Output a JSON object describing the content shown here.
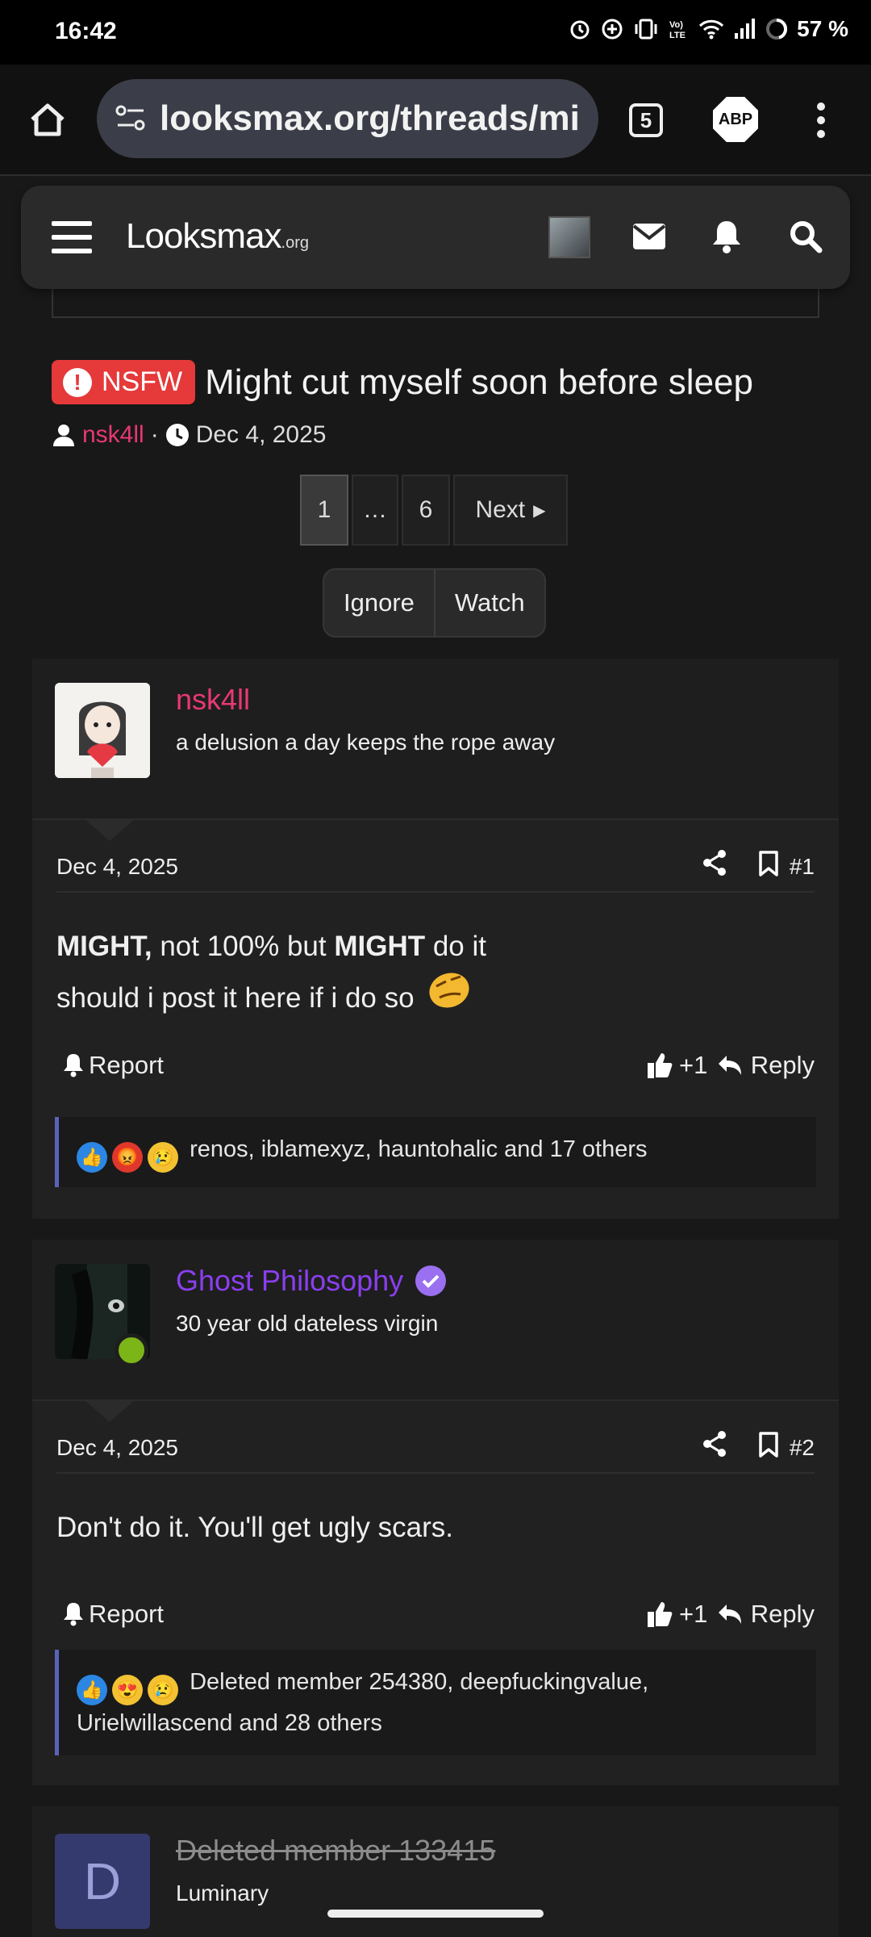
{
  "status": {
    "time": "16:42",
    "battery": "57 %"
  },
  "browser": {
    "url": "looksmax.org/threads/mi",
    "tab_count": "5",
    "adblock": "ABP"
  },
  "site": {
    "logo": "Looksmax",
    "logo_suffix": ".org"
  },
  "thread": {
    "prefix": "NSFW",
    "title": "Might cut myself soon before sleep",
    "author": "nsk4ll",
    "separator": "·",
    "date": "Dec 4, 2025"
  },
  "pagination": {
    "current": "1",
    "ellipsis": "…",
    "last": "6",
    "next": "Next"
  },
  "thread_actions": {
    "ignore": "Ignore",
    "watch": "Watch"
  },
  "posts": [
    {
      "username": "nsk4ll",
      "user_title": "a delusion a day keeps the rope away",
      "name_color": "#e83873",
      "date": "Dec 4, 2025",
      "number": "#1",
      "body_bold1": "MIGHT,",
      "body_text1": " not 100% but ",
      "body_bold2": "MIGHT",
      "body_text2": " do it",
      "body_line2": "should i post it here if i do so",
      "report": "Report",
      "like_count": "+1",
      "reply": "Reply",
      "reaction_icons": [
        "like-icon",
        "angry-icon",
        "sad-icon"
      ],
      "reactions": "renos, iblamexyz, hauntohalic and 17 others"
    },
    {
      "username": "Ghost Philosophy",
      "user_title": "30 year old dateless virgin",
      "name_color": "#8a3ff0",
      "date": "Dec 4, 2025",
      "number": "#2",
      "body": "Don't do it. You'll get ugly scars.",
      "report": "Report",
      "like_count": "+1",
      "reply": "Reply",
      "reaction_icons": [
        "like-icon",
        "love-icon",
        "sad-icon"
      ],
      "reactions": "Deleted member 254380, deepfuckingvalue, Urielwillascend and 28 others"
    },
    {
      "avatar_letter": "D",
      "username": "Deleted member 133415",
      "user_title": "Luminary"
    }
  ],
  "colors": {
    "accent": "#5964b8",
    "nsfw": "#e5393a",
    "online": "#7cb518"
  }
}
